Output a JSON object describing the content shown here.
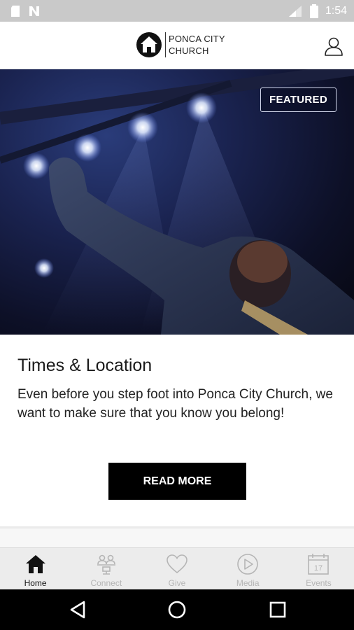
{
  "status_bar": {
    "time": "1:54",
    "left_icons": [
      "sd-card-icon",
      "notification-n-icon"
    ],
    "right_icons": [
      "signal-icon",
      "battery-icon"
    ]
  },
  "header": {
    "logo_text_line1": "PONCA CITY",
    "logo_text_line2": "CHURCH",
    "profile_icon": "user-icon"
  },
  "hero": {
    "badge": "FEATURED"
  },
  "card": {
    "title": "Times & Location",
    "body": "Even before you step foot into Ponca City Church, we want to make sure that you know you belong!",
    "button_label": "READ MORE"
  },
  "tabs": [
    {
      "label": "Home",
      "icon": "home-icon",
      "active": true
    },
    {
      "label": "Connect",
      "icon": "connect-icon",
      "active": false
    },
    {
      "label": "Give",
      "icon": "heart-icon",
      "active": false
    },
    {
      "label": "Media",
      "icon": "play-icon",
      "active": false
    },
    {
      "label": "Events",
      "icon": "calendar-icon",
      "active": false
    }
  ],
  "calendar_day": "17",
  "nav_bar": {
    "buttons": [
      "back-icon",
      "home-circle-icon",
      "recents-icon"
    ]
  },
  "colors": {
    "status_bar_bg": "#c9c9c9",
    "tab_bar_bg": "#ececec",
    "tab_active": "#111111",
    "tab_inactive": "#b5b5b5",
    "button_bg": "#000000"
  }
}
